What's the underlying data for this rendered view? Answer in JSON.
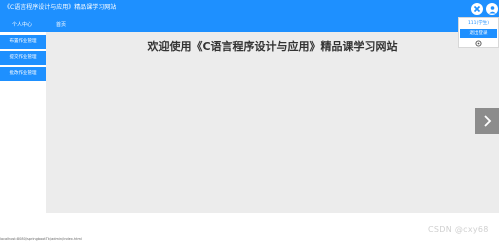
{
  "header": {
    "title": "《C语言程序设计与应用》精品课学习网站"
  },
  "nav": {
    "personal_center": "个人中心",
    "home": "首页"
  },
  "sidebar": {
    "items": [
      {
        "label": "布置作业管理"
      },
      {
        "label": "提交作业管理"
      },
      {
        "label": "批改作业管理"
      }
    ]
  },
  "main": {
    "welcome_text": "欢迎使用《C语言程序设计与应用》精品课学习网站"
  },
  "user_menu": {
    "username": "111(学生)",
    "exit_label": "退出登录"
  },
  "status_bar": {
    "url": "localhost:8080/springbootTk/admin/index.html"
  },
  "watermark": "CSDN @cxy68",
  "colors": {
    "primary": "#1e90ff",
    "main_bg": "#ececec",
    "arrow_bg": "#8c8c8c"
  },
  "icons": {
    "close": "close-icon",
    "avatar": "user-avatar-icon",
    "next": "chevron-right-icon"
  }
}
